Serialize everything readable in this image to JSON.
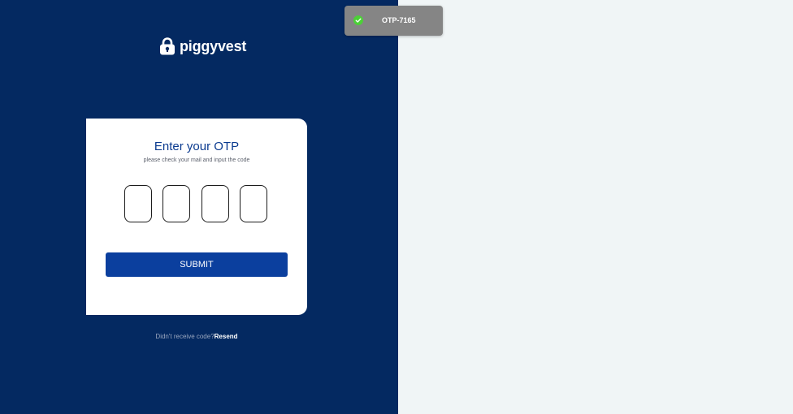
{
  "brand": {
    "name": "piggyvest",
    "icon": "padlock-icon"
  },
  "otp_card": {
    "title": "Enter your OTP",
    "subtitle": "please check your mail and input the code",
    "inputs": [
      "",
      "",
      "",
      ""
    ],
    "submit_label": "SUBMIT"
  },
  "resend": {
    "prompt": "Didn't receive code?",
    "link_label": "Resend"
  },
  "toast": {
    "icon": "check-circle-icon",
    "message": "OTP-7165"
  },
  "colors": {
    "left_panel": "#042961",
    "right_panel": "#f0f5f6",
    "primary_button": "#0b3f9e",
    "title": "#0a3a8f",
    "toast_bg": "#858585",
    "success": "#4cd137"
  }
}
